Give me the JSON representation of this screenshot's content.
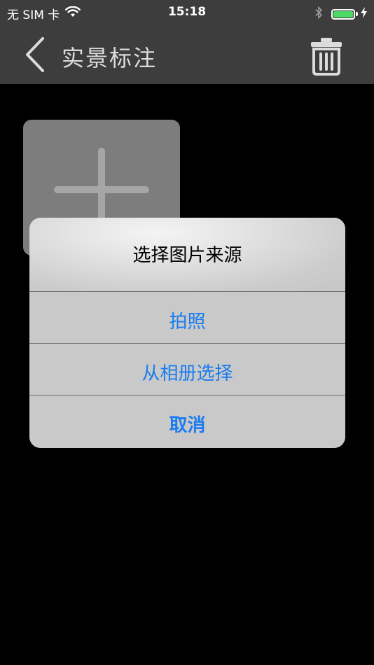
{
  "status_bar": {
    "carrier": "无 SIM 卡",
    "time": "15:18",
    "battery_level": 1.0,
    "battery_color": "#4cd964"
  },
  "nav_bar": {
    "title": "实景标注",
    "back_icon": "chevron-left-icon",
    "trash_icon": "trash-icon"
  },
  "add_tile": {
    "icon": "plus-icon"
  },
  "alert": {
    "title": "选择图片来源",
    "actions": [
      {
        "label": "拍照"
      },
      {
        "label": "从相册选择"
      },
      {
        "label": "取消"
      }
    ],
    "accent_color": "#1a7cf0"
  }
}
